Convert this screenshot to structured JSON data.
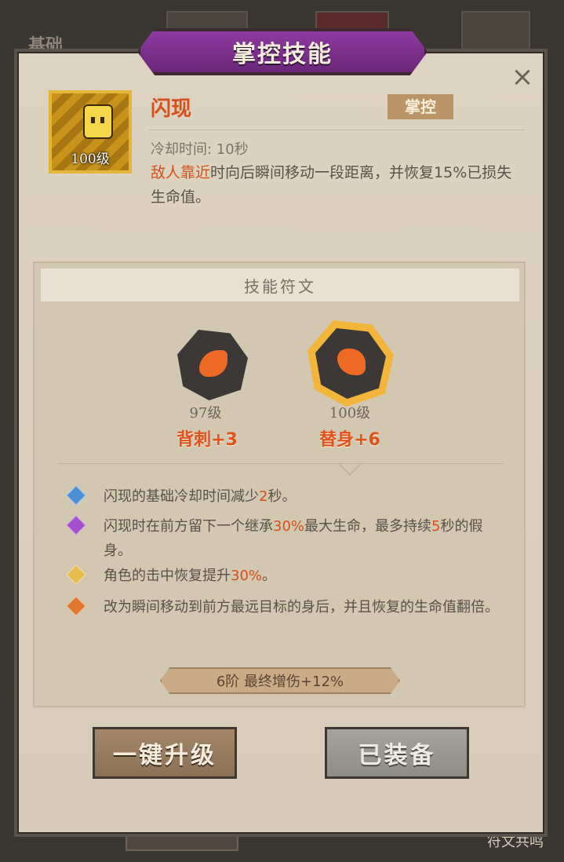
{
  "background": {
    "left_label": "基础",
    "bottom_right_label": "符文共鸣"
  },
  "dialog": {
    "title": "掌控技能",
    "close_icon": "×"
  },
  "skill": {
    "level": "100级",
    "name": "闪现",
    "tag": "掌控",
    "cooldown": "冷却时间: 10秒",
    "desc_highlight": "敌人靠近",
    "desc_rest": "时向后瞬间移动一段距离，并恢复15%已损失生命值。"
  },
  "runes": {
    "header": "技能符文",
    "items": [
      {
        "level": "97级",
        "name": "背刺+3",
        "glow": false
      },
      {
        "level": "100级",
        "name": "替身+6",
        "glow": true
      }
    ]
  },
  "effects": [
    {
      "color": "#4b8fd6",
      "parts": [
        "闪现的基础冷却时间减少",
        "2",
        "秒。"
      ]
    },
    {
      "color": "#a44fd0",
      "parts": [
        "闪现时在前方留下一个继承",
        "30%",
        "最大生命，最多持续",
        "5",
        "秒的假身。"
      ]
    },
    {
      "color": "#e5bd4d",
      "parts": [
        "角色的击中恢复提升",
        "30%",
        "。"
      ]
    },
    {
      "color": "#e0772c",
      "parts": [
        "改为瞬间移动到前方最远目标的身后，并且恢复的生命值翻倍。"
      ]
    }
  ],
  "tier_bonus": "6阶 最终增伤+12%",
  "buttons": {
    "upgrade": "一键升级",
    "equipped": "已装备"
  }
}
